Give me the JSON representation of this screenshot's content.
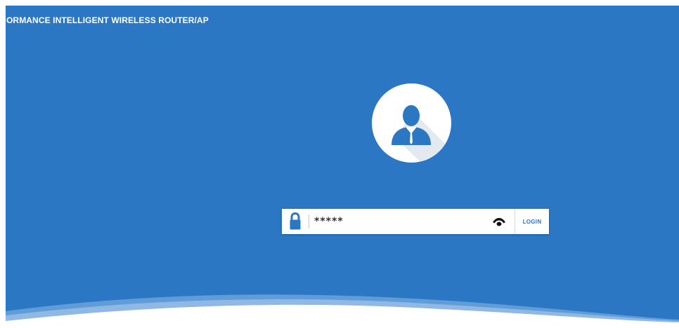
{
  "header": {
    "title": "ORMANCE INTELLIGENT WIRELESS ROUTER/AP"
  },
  "login": {
    "password_value": "*****",
    "login_label": "LOGIN"
  },
  "icons": {
    "avatar": "user-avatar-icon",
    "lock": "lock-icon",
    "eye": "eye-icon"
  },
  "colors": {
    "background_blue": "#2b77c4",
    "icon_blue": "#2b77c4",
    "wave_light": "#8fb8e4",
    "white": "#ffffff"
  }
}
